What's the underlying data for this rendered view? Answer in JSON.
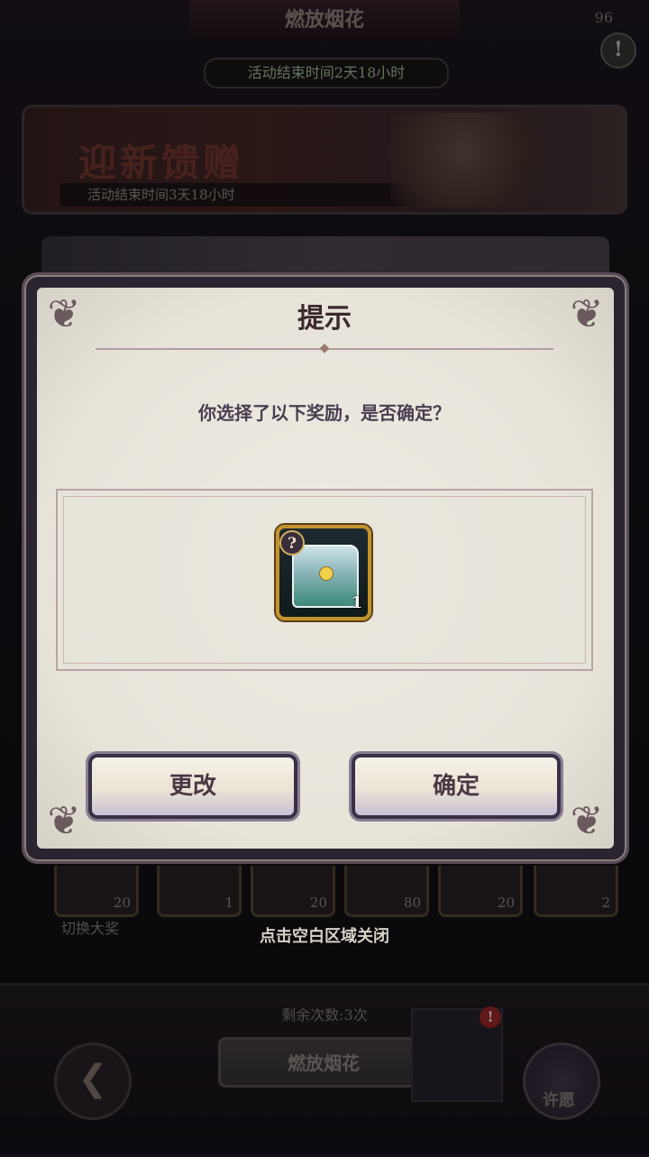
{
  "background": {
    "top_title": "燃放烟花",
    "top_counter": "96",
    "alert_icon": "exclamation-icon",
    "event_timer": "活动结束时间2天18小时",
    "banner": {
      "title": "迎新馈赠",
      "timer": "活动结束时间3天18小时"
    },
    "reward_slots": [
      "20",
      "1",
      "20",
      "80",
      "20",
      "2"
    ],
    "switch_label": "切换大奖",
    "remaining": "剩余次数:3次",
    "fire_button": "燃放烟花",
    "wish_label": "许愿",
    "red_dot": "!"
  },
  "close_hint": "点击空白区域关闭",
  "dialog": {
    "title": "提示",
    "question": "你选择了以下奖励，是否确定？",
    "item": {
      "icon": "treasure-chest-icon",
      "badge": "?",
      "count": "1"
    },
    "change_button": "更改",
    "confirm_button": "确定"
  },
  "colors": {
    "dialog_bg": "#efece4",
    "item_border": "#c2932e",
    "button_border": "#3a3046"
  }
}
